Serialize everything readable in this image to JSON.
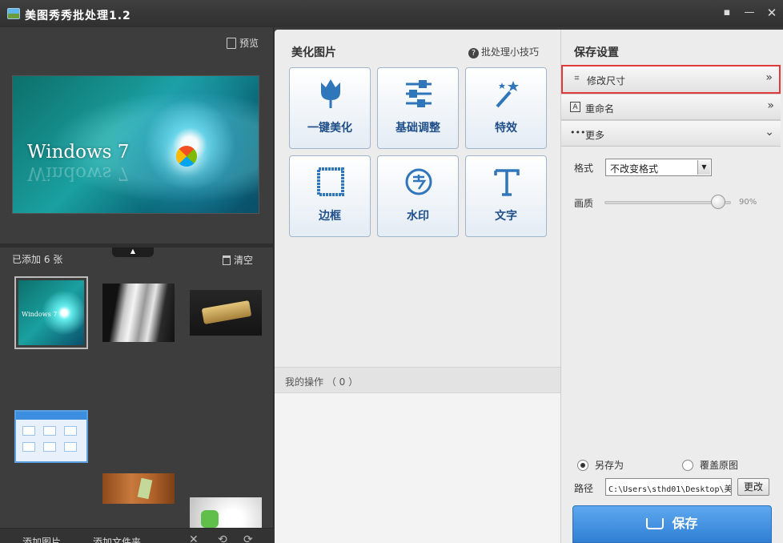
{
  "window": {
    "title": "美图秀秀批处理1.2"
  },
  "left": {
    "preview_label": "预览",
    "preview_image_text": "Windows 7",
    "added_count": "已添加 6 张",
    "clear_label": "清空",
    "thumb1_text": "Windows 7",
    "toolbar": {
      "add_image": "添加图片",
      "add_folder": "添加文件夹",
      "remove": "✕",
      "rotate_left": "⟲",
      "rotate_right": "⟳"
    }
  },
  "middle": {
    "title": "美化图片",
    "tips": "批处理小技巧",
    "tools": [
      {
        "label": "一键美化"
      },
      {
        "label": "基础调整"
      },
      {
        "label": "特效"
      },
      {
        "label": "边框"
      },
      {
        "label": "水印"
      },
      {
        "label": "文字"
      }
    ],
    "operations_label": "我的操作 （ 0 ）"
  },
  "right": {
    "title": "保存设置",
    "rows": [
      {
        "label": "修改尺寸",
        "chevron": "»"
      },
      {
        "label": "重命名",
        "chevron": "»"
      },
      {
        "label": "更多",
        "chevron": "⌄"
      }
    ],
    "format_label": "格式",
    "format_value": "不改变格式",
    "quality_label": "画质",
    "quality_value": "90%",
    "quality_level": 0.9,
    "save_as_label": "另存为",
    "overwrite_label": "覆盖原图",
    "path_label": "路径",
    "path_value": "C:\\Users\\sthd01\\Desktop\\美",
    "change_label": "更改",
    "save_label": "保存"
  },
  "colors": {
    "accent": "#2f7fd4",
    "highlight_border": "#e03a3a"
  }
}
